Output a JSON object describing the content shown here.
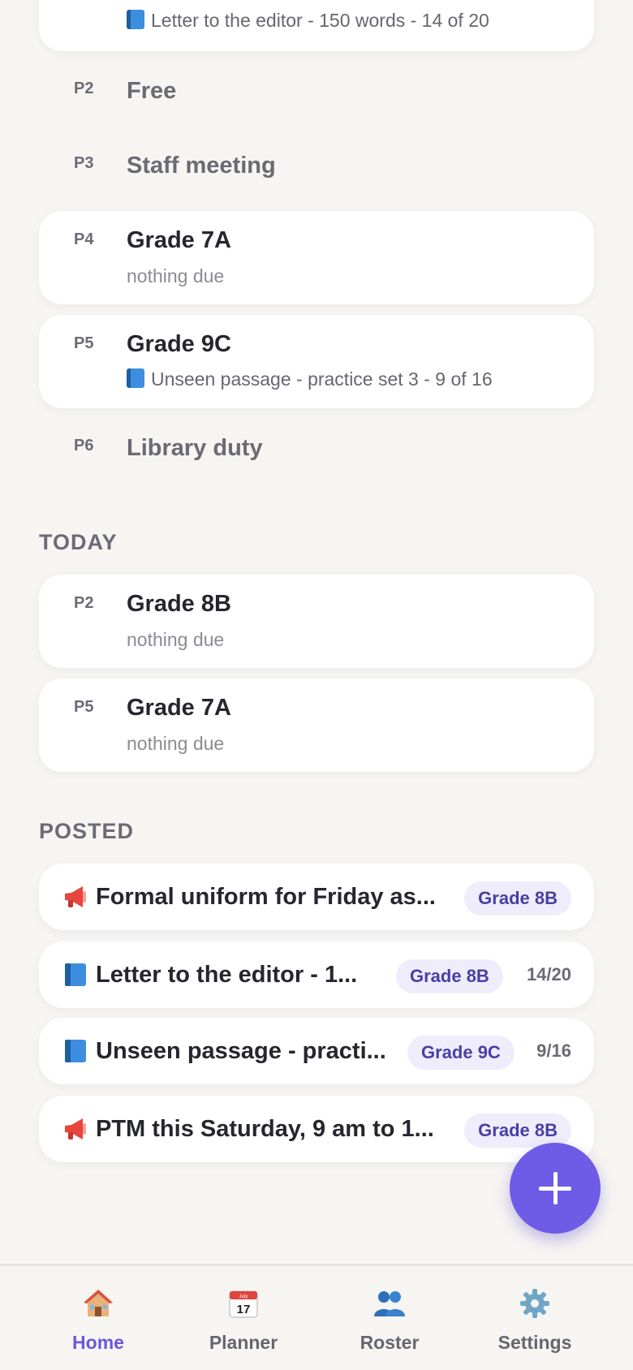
{
  "top_partial": {
    "task_text": "Letter to the editor - 150 words - 14 of 20"
  },
  "earlier_periods": [
    {
      "period": "P2",
      "title": "Free"
    },
    {
      "period": "P3",
      "title": "Staff meeting"
    },
    {
      "period": "P4",
      "title": "Grade 7A",
      "sub": "nothing due"
    },
    {
      "period": "P5",
      "title": "Grade 9C",
      "sub": "Unseen passage - practice set 3 - 9 of 16"
    },
    {
      "period": "P6",
      "title": "Library duty"
    }
  ],
  "today": {
    "label": "TODAY",
    "items": [
      {
        "period": "P2",
        "title": "Grade 8B",
        "sub": "nothing due"
      },
      {
        "period": "P5",
        "title": "Grade 7A",
        "sub": "nothing due"
      }
    ]
  },
  "posted": {
    "label": "POSTED",
    "items": [
      {
        "icon": "megaphone-icon",
        "title": "Formal uniform for Friday as...",
        "badge": "Grade 8B"
      },
      {
        "icon": "book-icon",
        "title": "Letter to the editor - 1...",
        "badge": "Grade 8B",
        "count": "14/20"
      },
      {
        "icon": "book-icon",
        "title": "Unseen passage - practi...",
        "badge": "Grade 9C",
        "count": "9/16"
      },
      {
        "icon": "megaphone-icon",
        "title": "PTM this Saturday, 9 am to 1...",
        "badge": "Grade 8B"
      }
    ]
  },
  "fab": {
    "icon": "plus-icon"
  },
  "nav": {
    "tabs": [
      {
        "label": "Home",
        "icon": "house-icon",
        "active": true
      },
      {
        "label": "Planner",
        "icon": "calendar-icon",
        "calendar_month": "July",
        "calendar_day": "17"
      },
      {
        "label": "Roster",
        "icon": "people-icon"
      },
      {
        "label": "Settings",
        "icon": "gear-icon"
      }
    ]
  },
  "colors": {
    "accent": "#6e5be6",
    "badge_bg": "#efedfb",
    "badge_text": "#4a3ea6",
    "background": "#f6f5f2"
  }
}
